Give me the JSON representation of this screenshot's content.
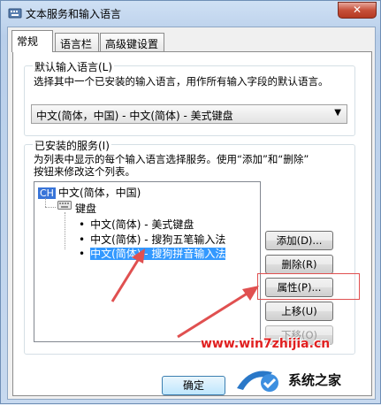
{
  "window": {
    "title": "文本服务和输入语言",
    "close_label": "✕"
  },
  "tabs": [
    {
      "label": "常规"
    },
    {
      "label": "语言栏"
    },
    {
      "label": "高级键设置"
    }
  ],
  "default_language": {
    "label": "默认输入语言(L)",
    "description": "选择其中一个已安装的输入语言，用作所有输入字段的默认语言。",
    "selected": "中文(简体，中国) - 中文(简体) - 美式键盘"
  },
  "installed_services": {
    "label": "已安装的服务(I)",
    "description_line1": "为列表中显示的每个输入语言选择服务。使用“添加”和“删除”",
    "description_line2": "按钮来修改这个列表。",
    "tree": {
      "language_code": "CH",
      "language": "中文(简体，中国)",
      "category": "键盘",
      "items": [
        {
          "label": "中文(简体) - 美式键盘",
          "selected": false
        },
        {
          "label": "中文(简体) - 搜狗五笔输入法",
          "selected": false
        },
        {
          "label": "中文(简体) - 搜狗拼音输入法",
          "selected": true
        }
      ]
    }
  },
  "buttons": {
    "add": "添加(D)...",
    "remove": "删除(R)",
    "properties": "属性(P)...",
    "move_up": "上移(U)",
    "move_down": "下移(O)",
    "ok": "确定"
  },
  "watermark": {
    "url": "www.win7zhijia.cn",
    "brand": "系统之家"
  },
  "colors": {
    "selection": "#3399ff",
    "annotation": "#e05050",
    "watermark": "#e02020"
  }
}
